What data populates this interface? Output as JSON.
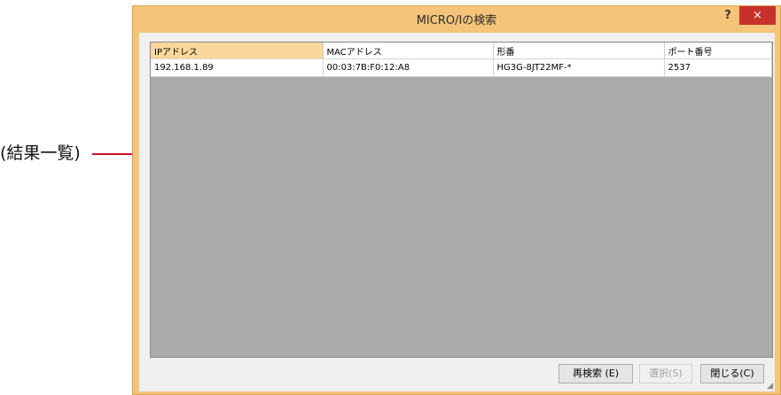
{
  "annotation": {
    "label": "(結果一覧)"
  },
  "dialog": {
    "title": "MICRO/Iの検索",
    "help_label": "?",
    "close_label": "×"
  },
  "results": {
    "columns": [
      "IPアドレス",
      "MACアドレス",
      "形番",
      "ポート番号"
    ],
    "rows": [
      [
        "192.168.1.89",
        "00:03:7B:F0:12:A8",
        "HG3G-8JT22MF-*",
        "2537"
      ]
    ]
  },
  "buttons": {
    "research": "再検索 (E)",
    "select": "選択(S)",
    "close": "閉じる(C)"
  },
  "colors": {
    "frame": "#f3c479",
    "close_button": "#c7312b",
    "callout_line": "#c8102e",
    "grid_background": "#ababab"
  }
}
